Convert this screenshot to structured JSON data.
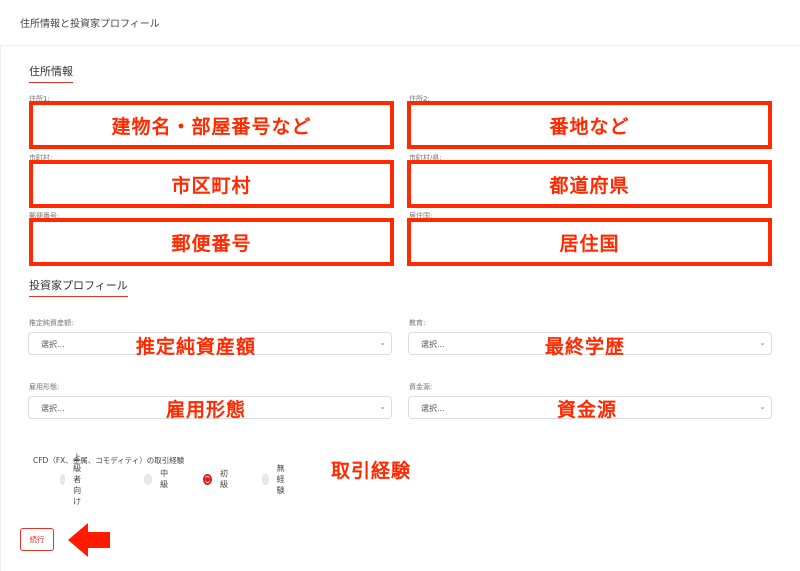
{
  "header": {
    "title": "住所情報と投資家プロフィール"
  },
  "address": {
    "section_title": "住所情報",
    "address1_label": "住所1:",
    "address1_note": "建物名・部屋番号など",
    "address2_label": "住所2:",
    "address2_note": "番地など",
    "city_label": "市町村:",
    "city_note": "市区町村",
    "prefecture_label": "市町村/県:",
    "prefecture_note": "都道府県",
    "postal_label": "郵便番号:",
    "postal_note": "郵便番号",
    "country_label": "居住国:",
    "country_note": "居住国"
  },
  "profile": {
    "section_title": "投資家プロフィール",
    "net_worth": {
      "label": "推定純資産額:",
      "placeholder": "選択...",
      "note": "推定純資産額"
    },
    "education": {
      "label": "教育:",
      "placeholder": "選択...",
      "note": "最終学歴"
    },
    "employment": {
      "label": "雇用形態:",
      "placeholder": "選択...",
      "note": "雇用形態"
    },
    "source_of_funds": {
      "label": "資金源:",
      "placeholder": "選択...",
      "note": "資金源"
    },
    "cfd": {
      "label": "CFD（FX、金属、コモディティ）の取引経験",
      "note": "取引経験",
      "options": [
        "上級者向け",
        "中級",
        "初級",
        "無経験"
      ],
      "selected": "初級"
    }
  },
  "actions": {
    "continue_label": "続行"
  },
  "colors": {
    "accent": "#e0342b",
    "annotation": "#ff2a00"
  },
  "icons": {
    "chevron": "chevron-down-icon",
    "arrow": "arrow-left-icon"
  }
}
